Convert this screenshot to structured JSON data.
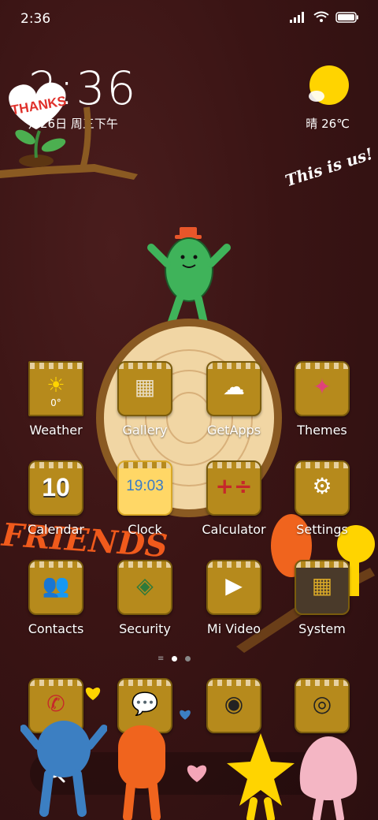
{
  "status_bar": {
    "time": "2:36"
  },
  "clock_widget": {
    "time": "2:36",
    "date": "月26日 周三下午"
  },
  "weather_widget": {
    "text": "晴 26℃"
  },
  "decor": {
    "thanks": "THANKS",
    "tagline": "This is us!",
    "friends": "FRIENDS"
  },
  "apps": [
    {
      "label": "Weather",
      "glyph": "0°"
    },
    {
      "label": "Gallery",
      "glyph": "▦"
    },
    {
      "label": "GetApps",
      "glyph": "☁"
    },
    {
      "label": "Themes",
      "glyph": "✦"
    },
    {
      "label": "Calendar",
      "glyph": "10"
    },
    {
      "label": "Clock",
      "glyph": "19:03"
    },
    {
      "label": "Calculator",
      "glyph": "+÷"
    },
    {
      "label": "Settings",
      "glyph": "⚙"
    },
    {
      "label": "Contacts",
      "glyph": "👥"
    },
    {
      "label": "Security",
      "glyph": "◈"
    },
    {
      "label": "Mi Video",
      "glyph": "▶"
    },
    {
      "label": "System",
      "glyph": "▦"
    }
  ],
  "dock": [
    {
      "name": "phone",
      "glyph": "✆"
    },
    {
      "name": "messages",
      "glyph": "💬"
    },
    {
      "name": "music",
      "glyph": "◉"
    },
    {
      "name": "camera",
      "glyph": "◎"
    }
  ],
  "colors": {
    "accent": "#b68a1c",
    "background": "#3a1414",
    "sun": "#ffd400"
  }
}
